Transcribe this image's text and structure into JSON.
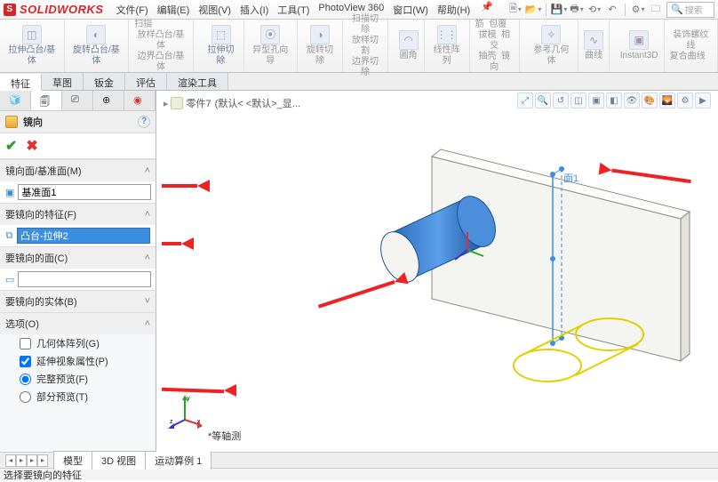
{
  "app": {
    "brand": "SOLIDWORKS"
  },
  "menu": {
    "file": "文件(F)",
    "edit": "编辑(E)",
    "view": "视图(V)",
    "insert": "插入(I)",
    "tools": "工具(T)",
    "photoview": "PhotoView 360",
    "window": "窗口(W)",
    "help": "帮助(H)"
  },
  "menuRightSearch": "搜索",
  "ribbon": {
    "g1": "拉伸凸台/基体",
    "g2": "旋转凸台/基体",
    "g3a": "扫描",
    "g3b": "放样凸台/基体",
    "g3c": "边界凸台/基体",
    "g4": "拉伸切除",
    "g5": "异型孔向导",
    "g6": "旋转切除",
    "g7a": "扫描切除",
    "g7b": "放样切割",
    "g7c": "边界切除",
    "g8": "圆角",
    "g9": "线性阵列",
    "g10a": "筋",
    "g10b": "拔模",
    "g10c": "抽壳",
    "g10d": "包覆",
    "g10e": "相交",
    "g10f": "镜向",
    "g11": "参考几何体",
    "g12": "曲线",
    "g13": "Instant3D",
    "g14a": "装饰螺纹线",
    "g14b": "复合曲线"
  },
  "cmtabs": {
    "feat": "特征",
    "sketch": "草图",
    "sheetmetal": "钣金",
    "evaluate": "评估",
    "render": "渲染工具"
  },
  "breadcrumb": {
    "part": "零件7",
    "state": "(默认< <默认>_显..."
  },
  "panel": {
    "title": "镜向",
    "sec_mirrorface": "镜向面/基准面(M)",
    "val_face": "基准面1",
    "sec_feat": "要镜向的特征(F)",
    "val_feat": "凸台-拉伸2",
    "sec_face2": "要镜向的面(C)",
    "val_face2": "",
    "sec_body": "要镜向的实体(B)",
    "sec_options": "选项(O)",
    "chk_geom": "几何体阵列(G)",
    "chk_ext": "延伸视象属性(P)",
    "rad_full": "完整预览(F)",
    "rad_part": "部分预览(T)"
  },
  "gfx": {
    "planeLabel": "面1",
    "iso": "*等轴测"
  },
  "btabs": {
    "model": "模型",
    "view3d": "3D 视图",
    "motion": "运动算例 1"
  },
  "status": {
    "msg": "选择要镜向的特征"
  }
}
